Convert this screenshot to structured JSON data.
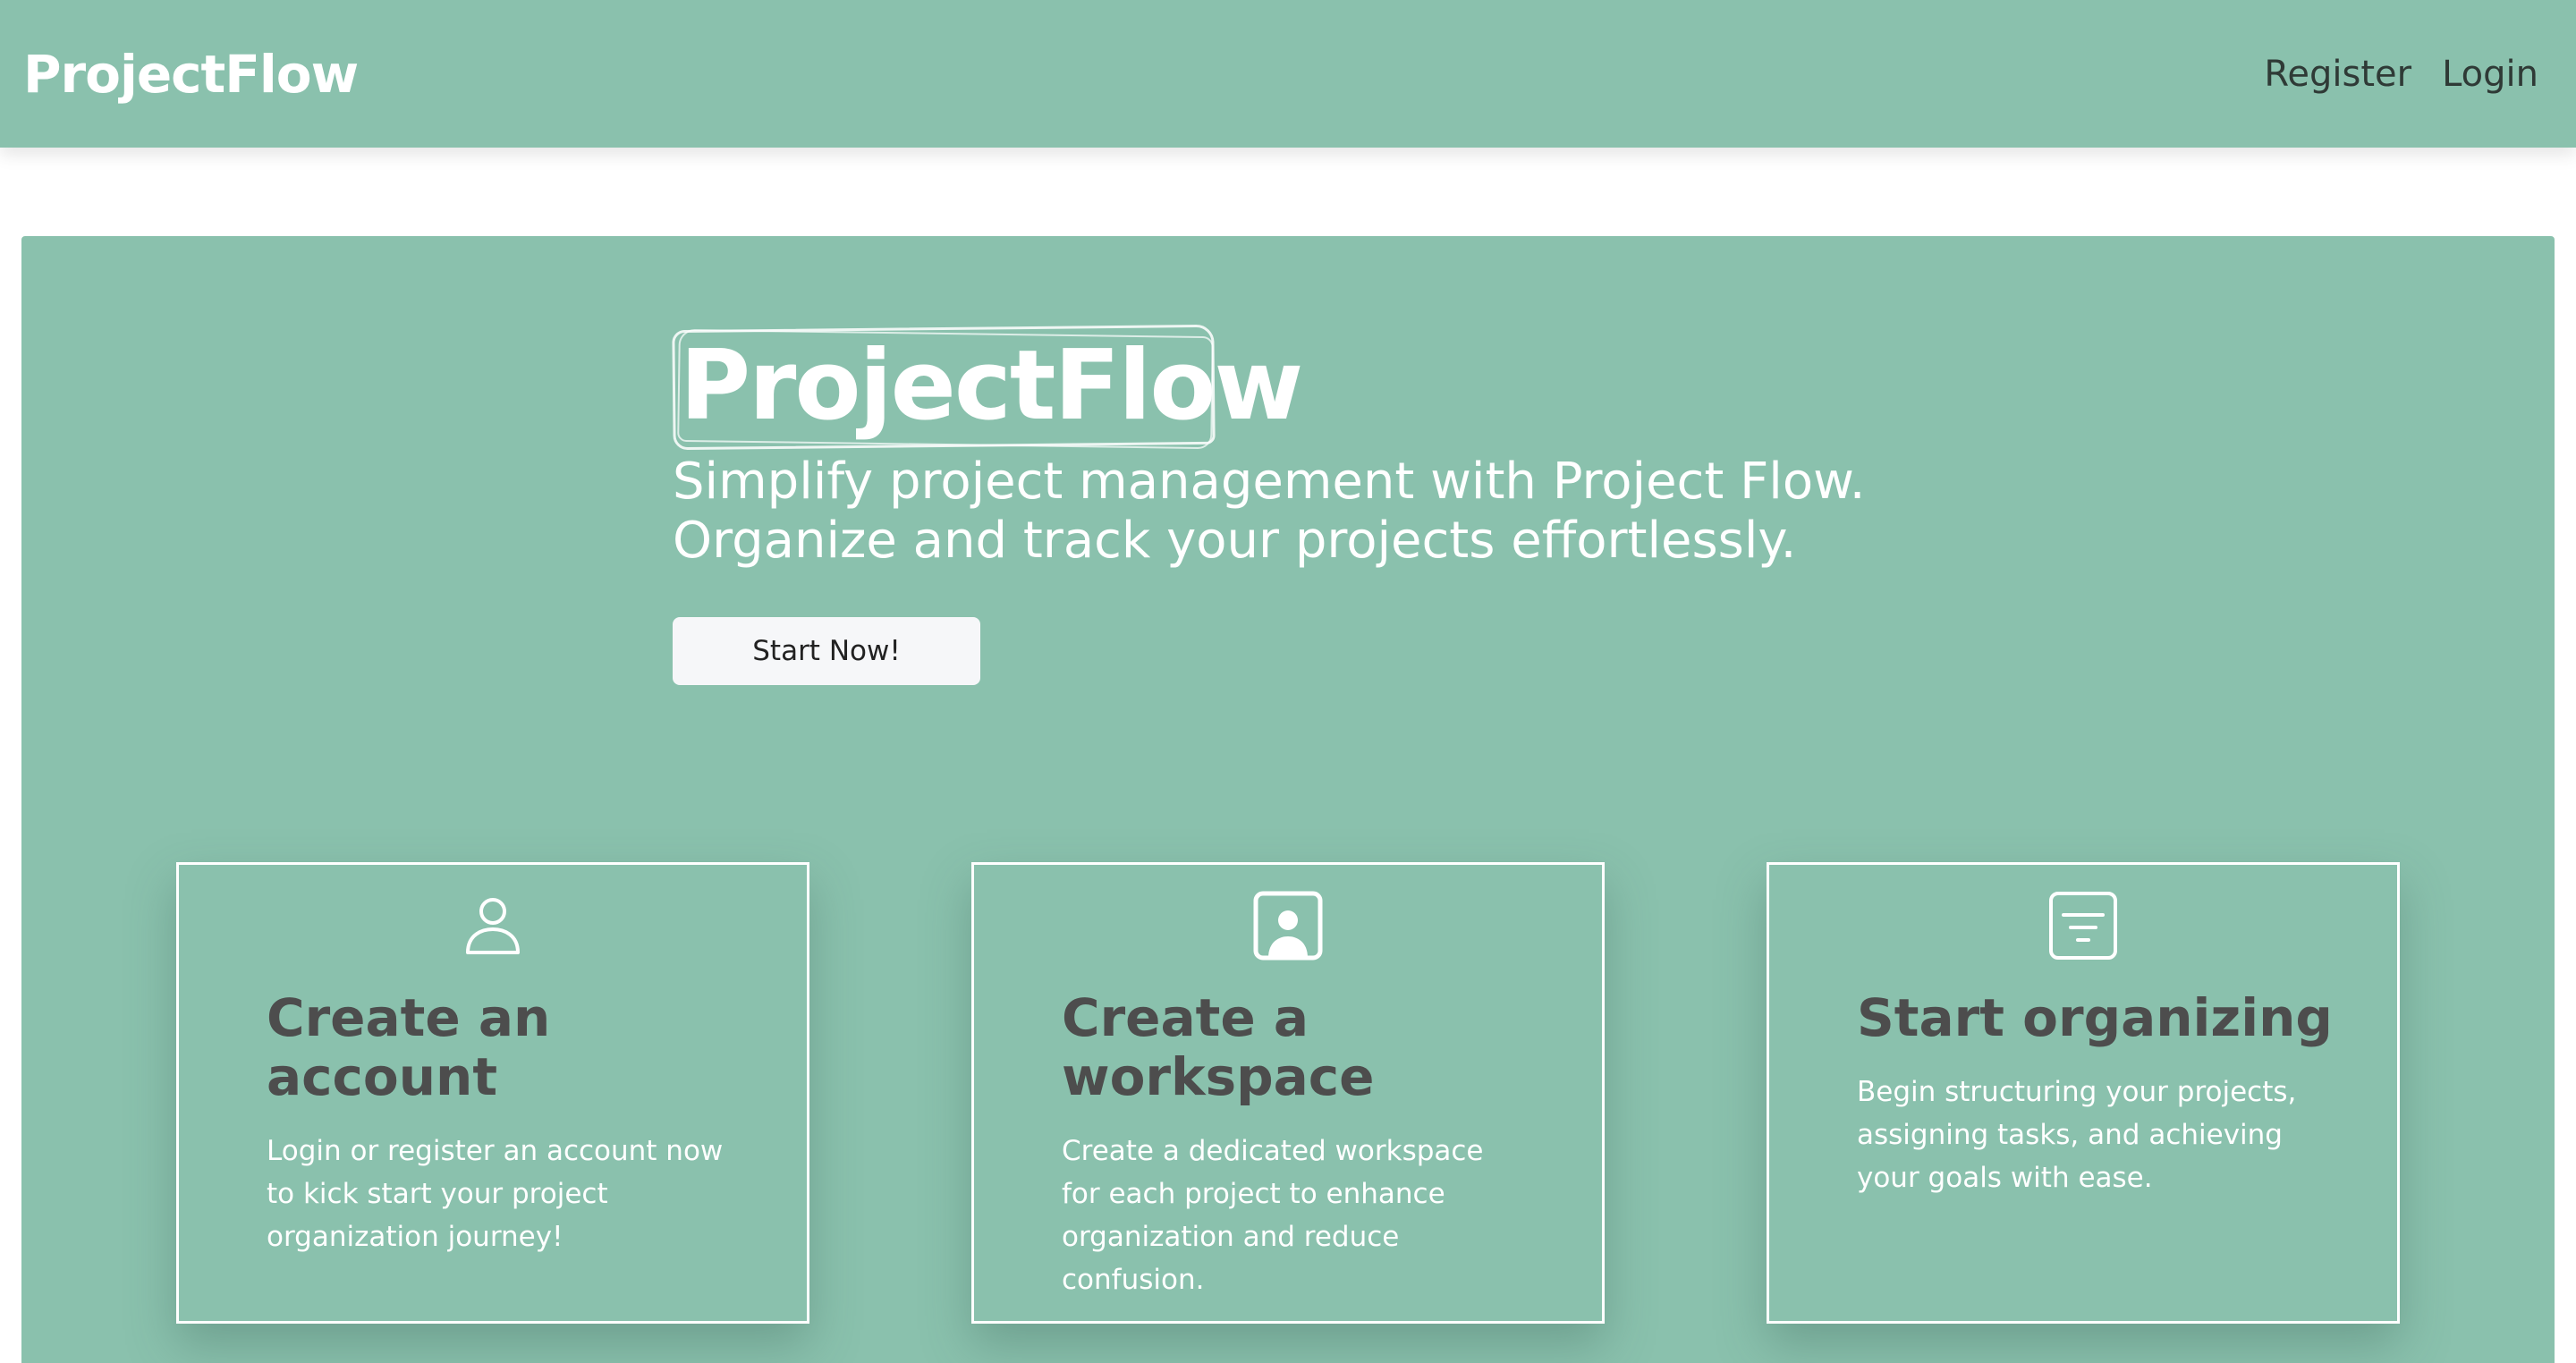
{
  "nav": {
    "brand": "ProjectFlow",
    "links": [
      "Register",
      "Login"
    ]
  },
  "hero": {
    "title": "ProjectFlow",
    "subtitle": "Simplify project management with Project Flow. Organize and track your projects effortlessly.",
    "cta_label": "Start Now!"
  },
  "cards": [
    {
      "icon": "user-icon",
      "title": "Create an account",
      "text": "Login or register an account now to kick start your project organization journey!"
    },
    {
      "icon": "workspace-user-icon",
      "title": "Create a workspace",
      "text": "Create a dedicated workspace for each project to enhance organization and reduce confusion."
    },
    {
      "icon": "list-filter-icon",
      "title": "Start organizing",
      "text": "Begin structuring your projects, assigning tasks, and achieving your goals with ease."
    }
  ],
  "colors": {
    "brand_green": "#8ac1ad",
    "card_title": "#4d4d4d",
    "button_bg": "#f6f7f9"
  }
}
